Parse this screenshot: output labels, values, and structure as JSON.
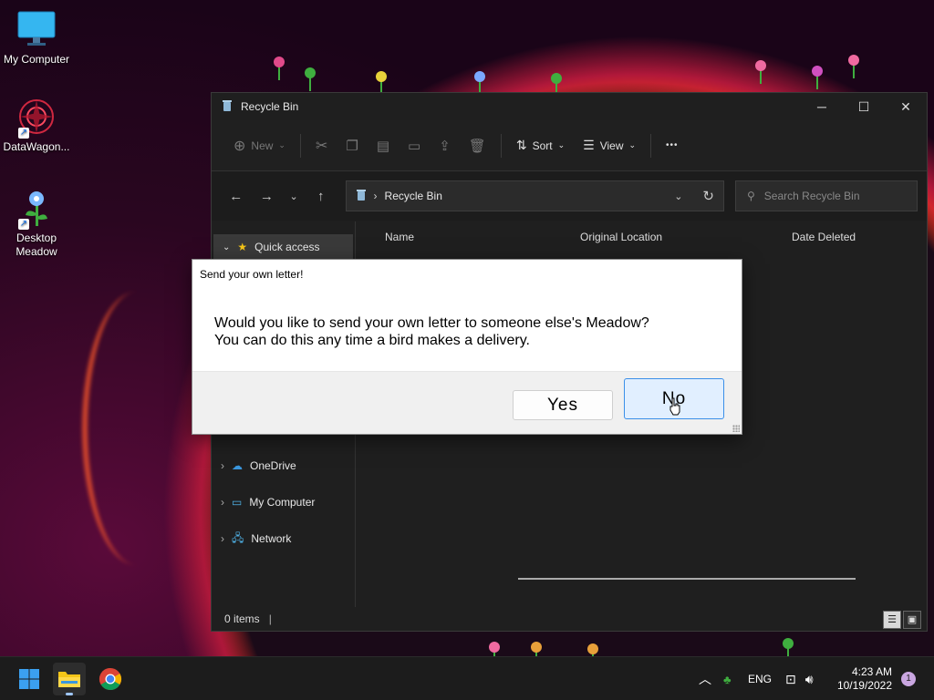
{
  "desktop": {
    "icons": [
      {
        "label": "My Computer"
      },
      {
        "label": "DataWagon..."
      },
      {
        "label": "Desktop Meadow"
      }
    ]
  },
  "explorer": {
    "title": "Recycle Bin",
    "window_buttons": {
      "minimize": "─",
      "maximize": "☐",
      "close": "✕"
    },
    "toolbar": {
      "new_label": "New",
      "sort_label": "Sort",
      "view_label": "View",
      "more_label": "•••"
    },
    "address": {
      "location": "Recycle Bin"
    },
    "search": {
      "placeholder": "Search Recycle Bin"
    },
    "nav_pane": {
      "items": [
        {
          "label": "Quick access"
        },
        {
          "label": "OneDrive"
        },
        {
          "label": "My Computer"
        },
        {
          "label": "Network"
        }
      ]
    },
    "columns": [
      "Name",
      "Original Location",
      "Date Deleted"
    ],
    "status": {
      "items": "0 items"
    }
  },
  "dialog": {
    "title": "Send your own letter!",
    "message_line1": "Would you like to send your own letter to someone else's Meadow?",
    "message_line2": "You can do this any time a bird makes a delivery.",
    "yes_label": "Yes",
    "no_label": "No"
  },
  "taskbar": {
    "language": "ENG",
    "time": "4:23 AM",
    "date": "10/19/2022",
    "notification_count": "1"
  },
  "colors": {
    "accent": "#3b8fe8",
    "dialog_default_button": "#e1efff",
    "window_bg": "#1f1f1f"
  }
}
